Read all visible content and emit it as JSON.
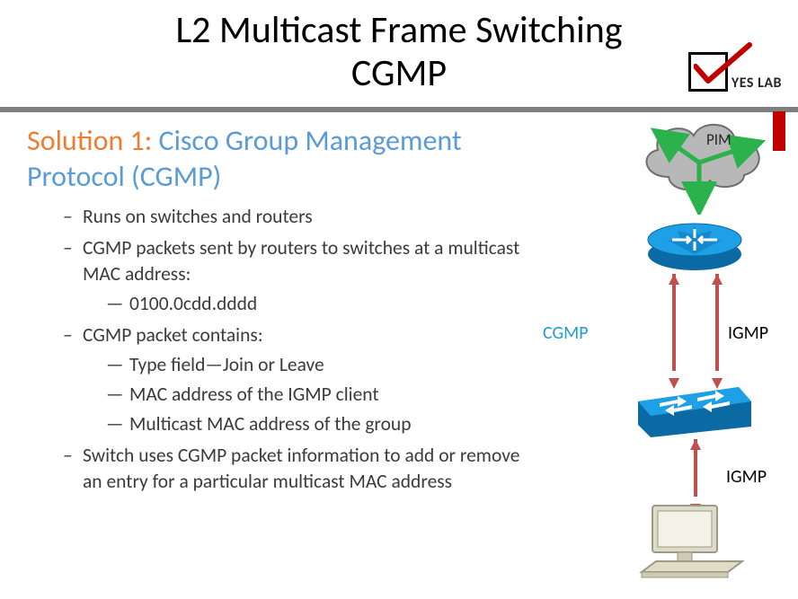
{
  "title_l1": "L2 Multicast Frame Switching",
  "title_l2": "CGMP",
  "logo_text": "YES LAB",
  "subtitle_label": "Solution 1:",
  "subtitle_value": "Cisco Group Management Protocol (CGMP)",
  "bullets": {
    "b0": "Runs on switches and routers",
    "b1": "CGMP packets sent by routers to switches at a multicast MAC address:",
    "b1a": "0100.0cdd.dddd",
    "b2": "CGMP packet contains:",
    "b2a": "Type field—Join or Leave",
    "b2b": "MAC address of the IGMP client",
    "b2c": "Multicast MAC address of the group",
    "b3": "Switch uses CGMP packet information to add or remove an entry for a particular multicast MAC address"
  },
  "labels": {
    "pim": "PIM",
    "cgmp": "CGMP",
    "igmp1": "IGMP",
    "igmp2": "IGMP"
  }
}
